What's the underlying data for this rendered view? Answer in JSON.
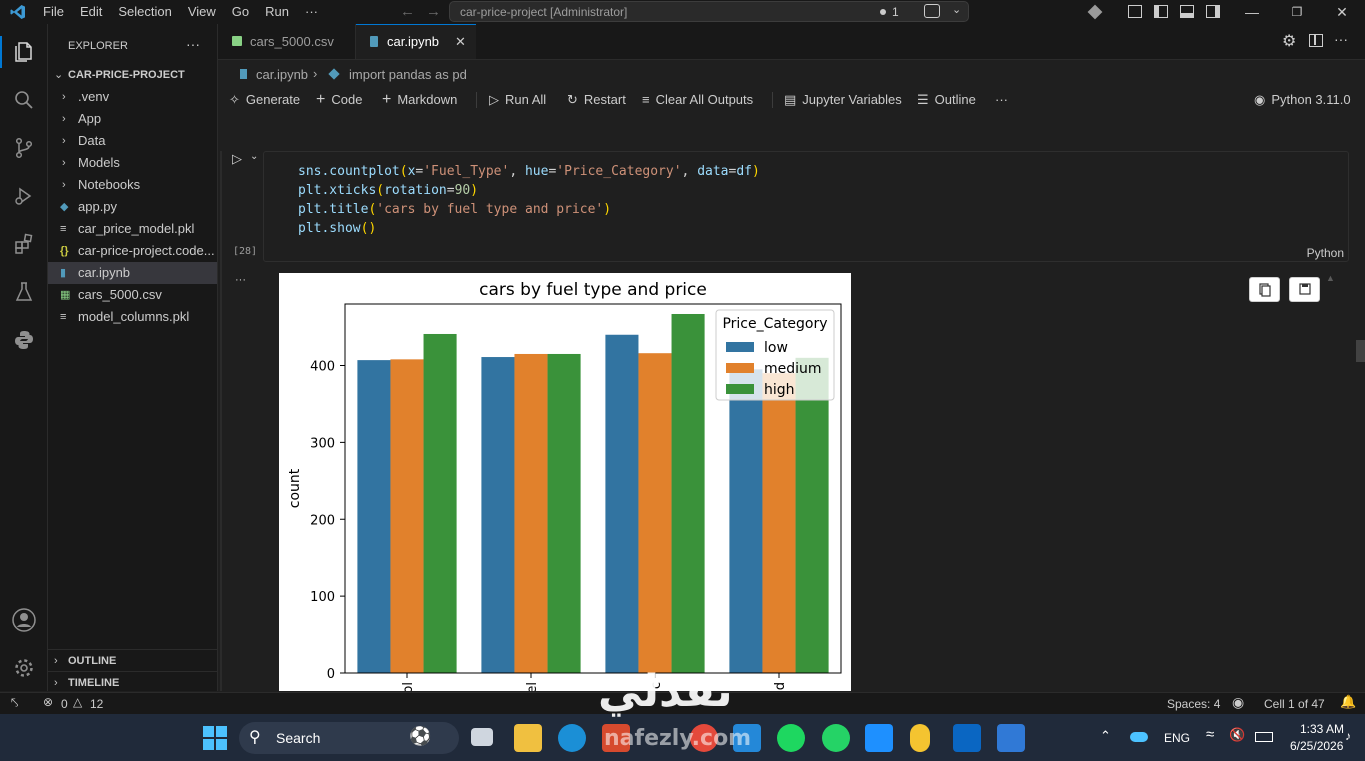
{
  "titlebar": {
    "menus": [
      "File",
      "Edit",
      "Selection",
      "View",
      "Go",
      "Run",
      "···"
    ],
    "search_text": "car-price-project [Administrator]",
    "badge_count": "1"
  },
  "explorer": {
    "header": "EXPLORER",
    "project": "CAR-PRICE-PROJECT",
    "items": [
      {
        "label": ".venv",
        "kind": "folder"
      },
      {
        "label": "App",
        "kind": "folder"
      },
      {
        "label": "Data",
        "kind": "folder"
      },
      {
        "label": "Models",
        "kind": "folder"
      },
      {
        "label": "Notebooks",
        "kind": "folder"
      },
      {
        "label": "app.py",
        "kind": "python"
      },
      {
        "label": "car_price_model.pkl",
        "kind": "text"
      },
      {
        "label": "car-price-project.code...",
        "kind": "json"
      },
      {
        "label": "car.ipynb",
        "kind": "notebook",
        "selected": true
      },
      {
        "label": "cars_5000.csv",
        "kind": "csv"
      },
      {
        "label": "model_columns.pkl",
        "kind": "text"
      }
    ],
    "outline": "OUTLINE",
    "timeline": "TIMELINE"
  },
  "tabs": [
    {
      "label": "cars_5000.csv",
      "active": false
    },
    {
      "label": "car.ipynb",
      "active": true
    }
  ],
  "breadcrumb": {
    "file": "car.ipynb",
    "sep": "›",
    "symbol": "import pandas as pd"
  },
  "toolbar": {
    "generate": "Generate",
    "code": "Code",
    "markdown": "Markdown",
    "run_all": "Run All",
    "restart": "Restart",
    "clear_outputs": "Clear All Outputs",
    "variables": "Jupyter Variables",
    "outline": "Outline",
    "more": "···",
    "kernel": "Python 3.11.0"
  },
  "cell": {
    "exec_count": "[28]",
    "language": "Python",
    "line1": {
      "fn": "sns.countplot",
      "open": "(",
      "k1": "x",
      "eq1": "=",
      "v1": "'Fuel_Type'",
      "c1": ", ",
      "k2": "hue",
      "eq2": "=",
      "v2": "'Price_Category'",
      "c2": ", ",
      "k3": "data",
      "eq3": "=",
      "v3": "df",
      "close": ")"
    },
    "line2": {
      "fn": "plt.xticks",
      "open": "(",
      "k1": "rotation",
      "eq1": "=",
      "v1": "90",
      "close": ")"
    },
    "line3": {
      "fn": "plt.title",
      "open": "(",
      "v1": "'cars by fuel type and price'",
      "close": ")"
    },
    "line4": {
      "fn": "plt.show",
      "open": "(",
      "close": ")"
    }
  },
  "chart_data": {
    "type": "bar",
    "title": "cars by fuel type and price",
    "xlabel": "",
    "ylabel": "count",
    "ylim": [
      0,
      480
    ],
    "yticks": [
      0,
      100,
      200,
      300,
      400
    ],
    "categories": [
      "ol",
      "el",
      "c",
      "d"
    ],
    "series": [
      {
        "name": "low",
        "color": "#3274a1",
        "values": [
          407,
          411,
          440,
          395
        ]
      },
      {
        "name": "medium",
        "color": "#e1812c",
        "values": [
          408,
          415,
          416,
          390
        ]
      },
      {
        "name": "high",
        "color": "#3a923a",
        "values": [
          441,
          415,
          467,
          410
        ]
      }
    ],
    "legend": {
      "title": "Price_Category",
      "placement": "top-right"
    },
    "grid": false
  },
  "statusbar": {
    "errors": "0",
    "warnings": "12",
    "spaces": "Spaces: 4",
    "cell_pos": "Cell 1 of 47"
  },
  "taskbar": {
    "search": "Search",
    "lang": "ENG",
    "time": "1:33 AM",
    "date": "6/25/2026"
  },
  "watermark": {
    "arabic": "نفذلي",
    "latin": "nafezly.com"
  }
}
